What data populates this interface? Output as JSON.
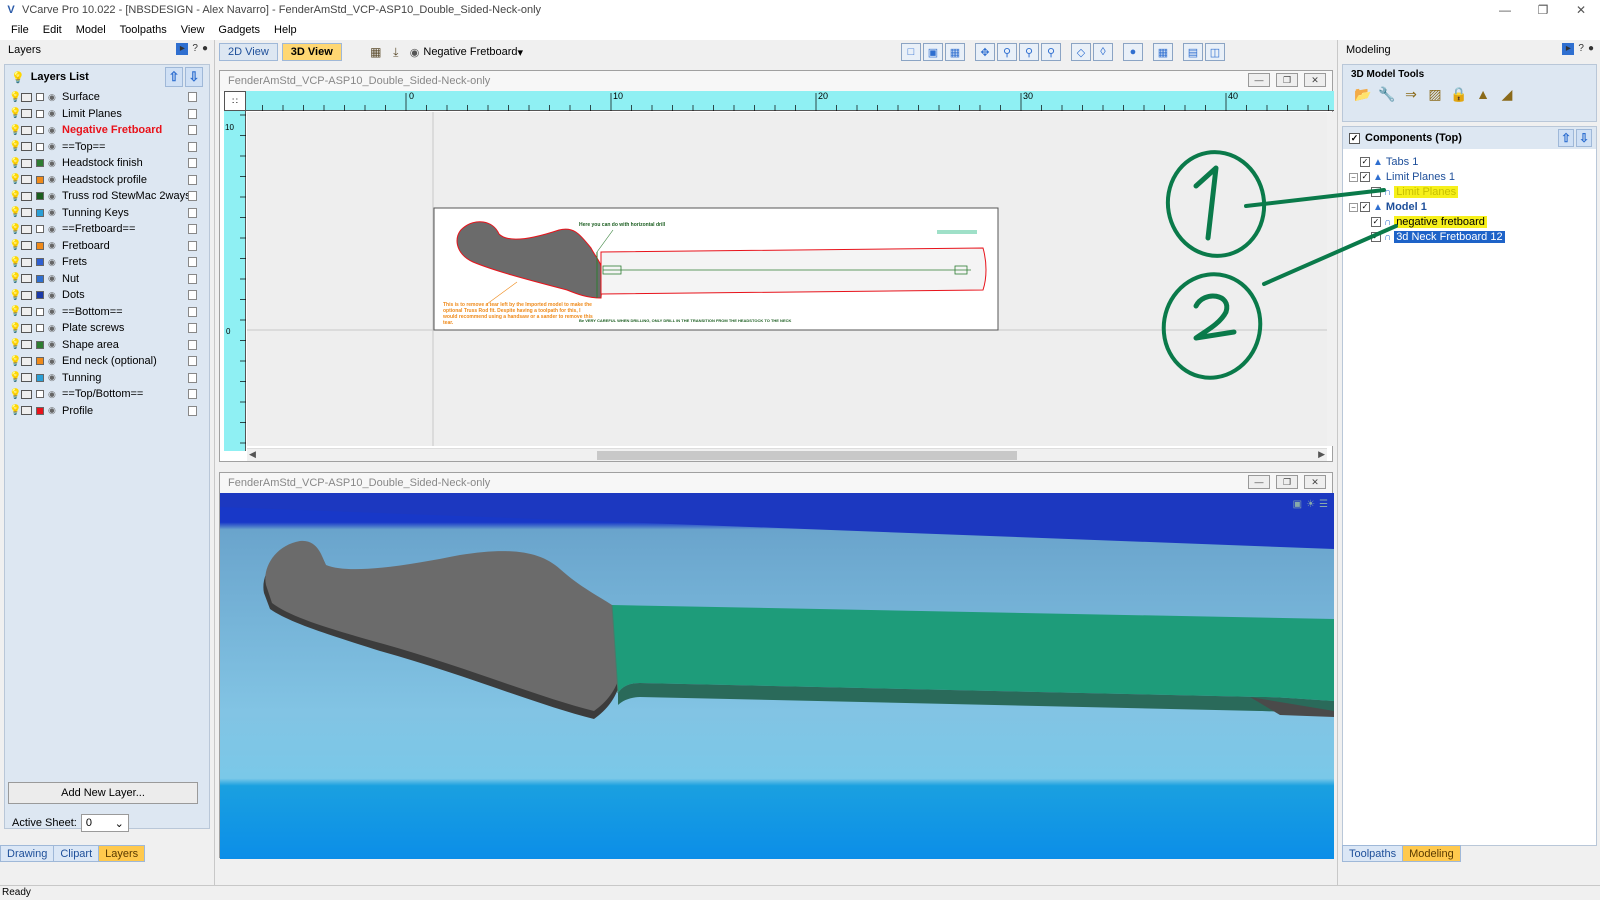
{
  "window": {
    "title": "VCarve Pro 10.022 - [NBSDESIGN - Alex Navarro] - FenderAmStd_VCP-ASP10_Double_Sided-Neck-only",
    "app_icon": "vcarve-v-icon",
    "controls": [
      "minimize",
      "restore",
      "close"
    ]
  },
  "menu": [
    "File",
    "Edit",
    "Model",
    "Toolpaths",
    "View",
    "Gadgets",
    "Help"
  ],
  "left_panel": {
    "title": "Layers",
    "list_title": "Layers List",
    "layers": [
      {
        "name": "Surface",
        "color": "#ffffff",
        "active": false
      },
      {
        "name": "Limit Planes",
        "color": "#ffffff",
        "active": false
      },
      {
        "name": "Negative Fretboard",
        "color": "#ffffff",
        "active": true
      },
      {
        "name": "==Top==",
        "color": "#ffffff",
        "active": false
      },
      {
        "name": "Headstock finish",
        "color": "#2e7d32",
        "active": false
      },
      {
        "name": "Headstock profile",
        "color": "#ef8a1a",
        "active": false
      },
      {
        "name": "Truss rod StewMac 2ways",
        "color": "#1b5e20",
        "active": false
      },
      {
        "name": "Tunning Keys",
        "color": "#2a9fd6",
        "active": false
      },
      {
        "name": "==Fretboard==",
        "color": "#ffffff",
        "active": false
      },
      {
        "name": "Fretboard",
        "color": "#ef8a1a",
        "active": false
      },
      {
        "name": "Frets",
        "color": "#2f5fd0",
        "active": false
      },
      {
        "name": "Nut",
        "color": "#2f6fd0",
        "active": false
      },
      {
        "name": "Dots",
        "color": "#1a3aa8",
        "active": false
      },
      {
        "name": "==Bottom==",
        "color": "#ffffff",
        "active": false
      },
      {
        "name": "Plate screws",
        "color": "#ffffff",
        "active": false
      },
      {
        "name": "Shape area",
        "color": "#2e7d32",
        "active": false
      },
      {
        "name": "End neck (optional)",
        "color": "#ef8a1a",
        "active": false
      },
      {
        "name": "Tunning",
        "color": "#2a9fd6",
        "active": false
      },
      {
        "name": "==Top/Bottom==",
        "color": "#ffffff",
        "active": false
      },
      {
        "name": "Profile",
        "color": "#e8131b",
        "active": false
      }
    ],
    "add_layer_label": "Add New Layer...",
    "active_sheet_label": "Active Sheet:",
    "active_sheet_value": "0",
    "tabs": [
      {
        "label": "Drawing",
        "selected": false
      },
      {
        "label": "Clipart",
        "selected": false
      },
      {
        "label": "Layers",
        "selected": true
      }
    ]
  },
  "view_toolbar": {
    "view_2d_label": "2D View",
    "view_3d_label": "3D View",
    "layer_selector": "Negative Fretboard"
  },
  "window_2d": {
    "title": "FenderAmStd_VCP-ASP10_Double_Sided-Neck-only",
    "ruler_h_ticks": [
      "0",
      "10",
      "20",
      "30",
      "40"
    ],
    "ruler_v_ticks": [
      "10",
      "0"
    ],
    "drawing_note_top": "Here you can do with horizontal drill",
    "drawing_note_left": "This is to remove a tear left by the Imported model to make the optional Truss Rod fit. Despite having a toolpath for this, I would recommend using a handsaw or a sander to remove this tear.",
    "drawing_note_bottom": "Be VERY CAREFUL WHEN DRILLING, ONLY DRILL IN THE TRANSITION FROM THE HEADSTOCK TO THE NECK"
  },
  "window_3d": {
    "title": "FenderAmStd_VCP-ASP10_Double_Sided-Neck-only"
  },
  "right_panel": {
    "title": "Modeling",
    "tools_title": "3D Model Tools",
    "tool_icons": [
      "folder-icon",
      "wrench-icon",
      "arrow-right-icon",
      "shade-icon",
      "lock-icon",
      "mound-icon",
      "slice-icon"
    ],
    "components_title": "Components (Top)",
    "components": [
      {
        "label": "Tabs 1",
        "level": 0,
        "checked": true,
        "expander": false,
        "style": "normal"
      },
      {
        "label": "Limit Planes 1",
        "level": 0,
        "checked": true,
        "expander": true,
        "style": "normal"
      },
      {
        "label": "Limit Planes",
        "level": 1,
        "checked": false,
        "expander": false,
        "style": "yellow-faded"
      },
      {
        "label": "Model 1",
        "level": 0,
        "checked": true,
        "expander": true,
        "style": "bold"
      },
      {
        "label": "negative fretboard",
        "level": 1,
        "checked": true,
        "expander": false,
        "style": "yellow"
      },
      {
        "label": "3d Neck Fretboard 12",
        "level": 1,
        "checked": true,
        "expander": false,
        "style": "blue"
      }
    ],
    "tabs": [
      {
        "label": "Toolpaths",
        "selected": false
      },
      {
        "label": "Modeling",
        "selected": true
      }
    ]
  },
  "annotations": [
    "1",
    "2"
  ],
  "status": "Ready",
  "colors": {
    "ruler": "#8ff0f3",
    "annotation": "#0a7a4a",
    "active_layer": "#e8131b",
    "fretboard": "#1e9c7a",
    "headstock": "#6b6b6b",
    "sky": "#6fb4d6"
  }
}
